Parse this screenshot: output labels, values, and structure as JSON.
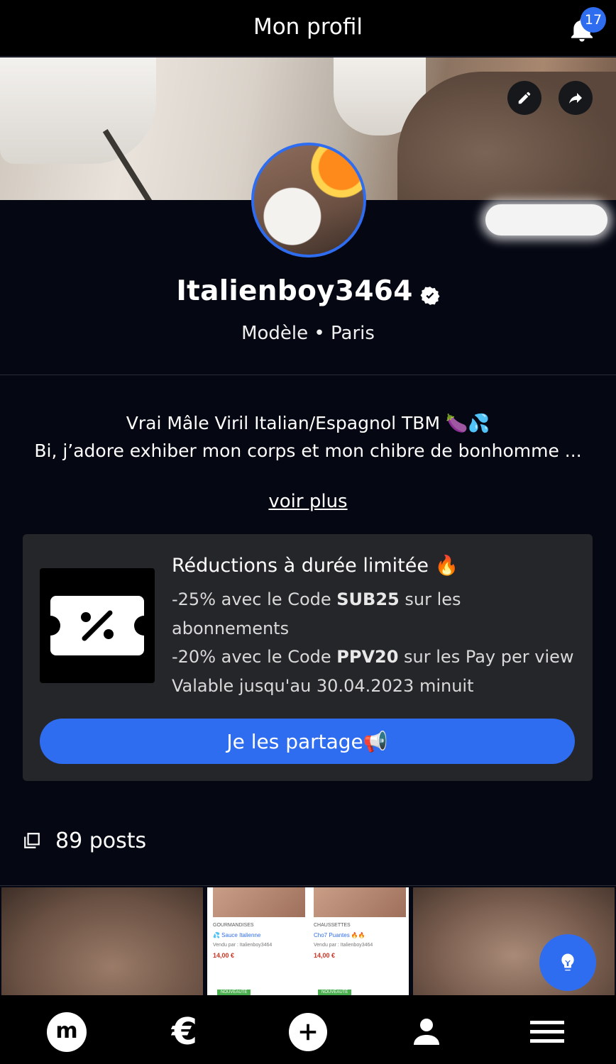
{
  "header": {
    "title": "Mon profil",
    "notification_count": "17"
  },
  "profile": {
    "username": "Italienboy3464",
    "subtitle": "Modèle • Paris",
    "bio_line1": "Vrai Mâle Viril Italian/Espagnol TBM 🍆💦",
    "bio_line2": "Bi, j’adore exhiber mon corps et mon chibre de bonhomme ...",
    "see_more": "voir plus"
  },
  "promo": {
    "title": "Réductions à durée limitée 🔥",
    "line1_prefix": "-25% avec le Code ",
    "line1_code": "SUB25",
    "line1_suffix": " sur les",
    "line2": "abonnements",
    "line3_prefix": "-20% avec le Code ",
    "line3_code": "PPV20",
    "line3_suffix": " sur les Pay per view",
    "line4": "Valable jusqu'au 30.04.2023 minuit",
    "share_button": "Je les partage📢"
  },
  "posts": {
    "count_label": "89 posts",
    "thumb2": {
      "left": {
        "category": "GOURMANDISES",
        "name": "💦 Sauce Italienne",
        "seller": "Vendu par : Italienboy3464",
        "price": "14,00 €",
        "badge": "NOUVEAUTÉ"
      },
      "right": {
        "category": "CHAUSSETTES",
        "name": "Cho7 Puantes 🔥🔥",
        "seller": "Vendu par : Italienboy3464",
        "price": "14,00 €",
        "badge": "NOUVEAUTÉ"
      }
    }
  },
  "bottom_nav": {
    "home_letter": "m",
    "money_symbol": "€"
  },
  "colors": {
    "accent": "#2f6df0",
    "background": "#050713",
    "card": "#252629"
  }
}
